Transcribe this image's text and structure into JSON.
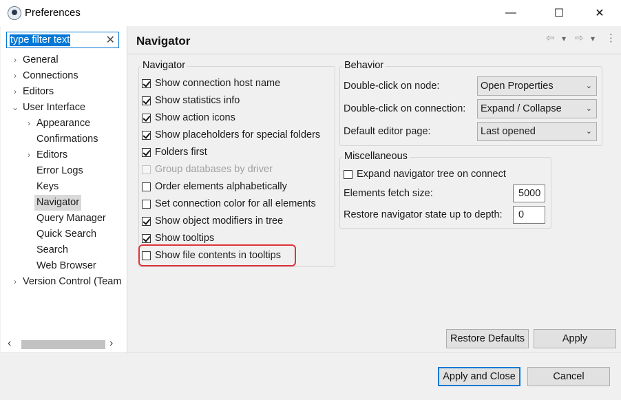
{
  "window": {
    "title": "Preferences",
    "controls": {
      "minimize": "—",
      "maximize": "☐",
      "close": "✕"
    }
  },
  "filter": {
    "value": "type filter text",
    "clear": "✕"
  },
  "tree": [
    {
      "label": "General",
      "expander": "›"
    },
    {
      "label": "Connections",
      "expander": "›"
    },
    {
      "label": "Editors",
      "expander": "›"
    },
    {
      "label": "User Interface",
      "expander": "⌄"
    },
    {
      "label": "Appearance",
      "expander": "›"
    },
    {
      "label": "Confirmations",
      "expander": ""
    },
    {
      "label": "Editors",
      "expander": "›"
    },
    {
      "label": "Error Logs",
      "expander": ""
    },
    {
      "label": "Keys",
      "expander": ""
    },
    {
      "label": "Navigator",
      "expander": ""
    },
    {
      "label": "Query Manager",
      "expander": ""
    },
    {
      "label": "Quick Search",
      "expander": ""
    },
    {
      "label": "Search",
      "expander": ""
    },
    {
      "label": "Web Browser",
      "expander": ""
    },
    {
      "label": "Version Control (Team",
      "expander": "›"
    }
  ],
  "scroll": {
    "left": "‹",
    "right": "›"
  },
  "page": {
    "title": "Navigator",
    "back": "⇦",
    "back_menu": "▾",
    "forward": "⇨",
    "forward_menu": "▾",
    "more": "⋮"
  },
  "navigator": {
    "label": "Navigator",
    "options": [
      {
        "label": "Show connection host name",
        "checked": true,
        "enabled": true
      },
      {
        "label": "Show statistics info",
        "checked": true,
        "enabled": true
      },
      {
        "label": "Show action icons",
        "checked": true,
        "enabled": true
      },
      {
        "label": "Show placeholders for special folders",
        "checked": true,
        "enabled": true
      },
      {
        "label": "Folders first",
        "checked": true,
        "enabled": true
      },
      {
        "label": "Group databases by driver",
        "checked": false,
        "enabled": false
      },
      {
        "label": "Order elements alphabetically",
        "checked": false,
        "enabled": true
      },
      {
        "label": "Set connection color for all elements",
        "checked": false,
        "enabled": true
      },
      {
        "label": "Show object modifiers in tree",
        "checked": true,
        "enabled": true
      },
      {
        "label": "Show tooltips",
        "checked": true,
        "enabled": true
      },
      {
        "label": "Show file contents in tooltips",
        "checked": false,
        "enabled": true
      }
    ]
  },
  "behavior": {
    "label": "Behavior",
    "rows": [
      {
        "label": "Double-click on node:",
        "value": "Open Properties"
      },
      {
        "label": "Double-click on connection:",
        "value": "Expand / Collapse"
      },
      {
        "label": "Default editor page:",
        "value": "Last opened"
      }
    ],
    "arrow": "⌄"
  },
  "misc": {
    "label": "Miscellaneous",
    "expand_label": "Expand navigator tree on connect",
    "expand_checked": false,
    "fetch_label": "Elements fetch size:",
    "fetch_value": "5000",
    "restore_label": "Restore navigator state up to depth:",
    "restore_value": "0"
  },
  "buttons": {
    "restore_defaults": "Restore Defaults",
    "apply": "Apply",
    "apply_close": "Apply and Close",
    "cancel": "Cancel"
  },
  "colors": {
    "accent": "#0078d7",
    "highlight": "#e0323a",
    "selection": "#d9d9d9"
  }
}
